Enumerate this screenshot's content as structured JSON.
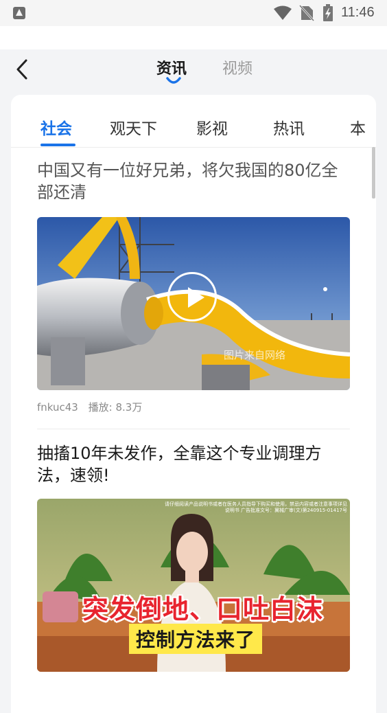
{
  "status_bar": {
    "time": "11:46"
  },
  "header": {
    "tabs": [
      {
        "label": "资讯",
        "active": true
      },
      {
        "label": "视频",
        "active": false
      }
    ]
  },
  "categories": [
    "社会",
    "观天下",
    "影视",
    "热讯",
    "本"
  ],
  "articles": [
    {
      "title": "中国又有一位好兄弟，将欠我国的80亿全部还清",
      "author": "fnkuc43",
      "plays": "播放: 8.3万",
      "image_watermark": "图片来自网络"
    },
    {
      "title": "抽搐10年未发作，全靠这个专业调理方法，速领!",
      "image_small_print": "请仔细阅读产品说明书或者在医务人员指导下购买和使用，禁忌内容或者注意事项详见说明书 广告批准文号：冀械广审(文)第240915-01417号",
      "image_caption": "突发倒地、口吐白沫",
      "image_subcaption": "控制方法来了"
    }
  ],
  "colors": {
    "accent": "#1a73e8",
    "page_bg": "#f3f4f6",
    "caption_red": "#e8242f",
    "caption_yellow": "#ffe84a"
  }
}
